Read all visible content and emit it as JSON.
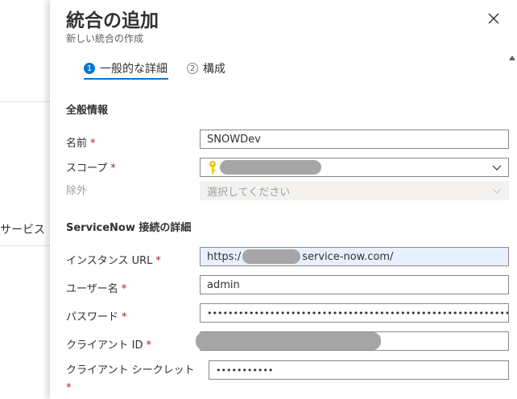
{
  "background": {
    "service_label": "サービス"
  },
  "panel": {
    "title": "統合の追加",
    "subtitle": "新しい統合の作成",
    "tabs": [
      {
        "number": "1",
        "label": "一般的な詳細",
        "active": true
      },
      {
        "number": "2",
        "label": "構成",
        "active": false
      }
    ],
    "accent_color": "#0078d4"
  },
  "general": {
    "section_title": "全般情報",
    "name_label": "名前",
    "name_value": "SNOWDev",
    "scope_label": "スコープ",
    "exclude_label": "除外",
    "exclude_placeholder": "選択してください"
  },
  "connection": {
    "section_title": "ServiceNow 接続の詳細",
    "instance_url_label": "インスタンス URL",
    "instance_url_prefix": "https:/",
    "instance_url_suffix": "service-now.com/",
    "username_label": "ユーザー名",
    "username_value": "admin",
    "password_label": "パスワード",
    "password_value": "•••••••••••••••••••••••••••••••••••••••••••••••••••••••••••",
    "client_id_label": "クライアント ID",
    "client_secret_label": "クライアント シークレット",
    "client_secret_value": "•••••••••••"
  },
  "required_marker": "*"
}
